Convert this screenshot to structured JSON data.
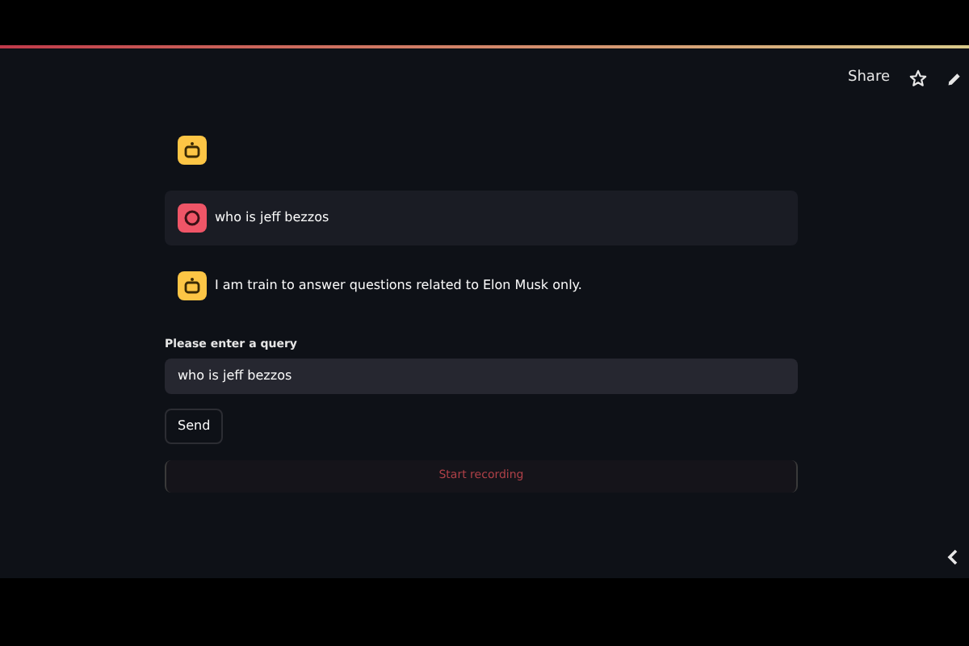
{
  "header": {
    "share": "Share"
  },
  "messages": [
    {
      "kind": "assistant"
    },
    {
      "kind": "user",
      "text": "who is jeff bezzos"
    },
    {
      "kind": "assistant",
      "text": "I am train to answer questions related to Elon Musk only."
    }
  ],
  "query": {
    "label": "Please enter a query",
    "value": "who is jeff bezzos"
  },
  "send_button": "Send",
  "recorder": {
    "label": "Start recording"
  }
}
